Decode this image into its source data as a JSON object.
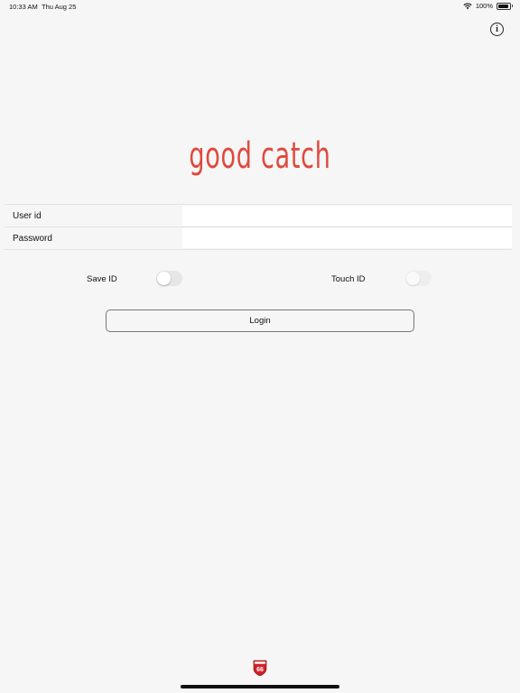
{
  "status_bar": {
    "time": "10:33 AM",
    "date": "Thu Aug 25",
    "battery_percent": "100%",
    "icons": [
      "wifi-icon",
      "battery-icon"
    ]
  },
  "header": {
    "info_icon": "info-icon"
  },
  "logo": {
    "text": "good catch",
    "color": "#e0493d"
  },
  "form": {
    "user_id": {
      "label": "User id",
      "value": "",
      "placeholder": ""
    },
    "password": {
      "label": "Password",
      "value": "",
      "placeholder": ""
    }
  },
  "toggles": {
    "save_id": {
      "label": "Save ID",
      "on": false
    },
    "touch_id": {
      "label": "Touch ID",
      "on": false,
      "enabled": false
    }
  },
  "login_button": {
    "label": "Login"
  },
  "footer": {
    "brand_badge": {
      "icon": "phillips66-logo-icon",
      "text": "66",
      "color": "#d32128"
    }
  }
}
